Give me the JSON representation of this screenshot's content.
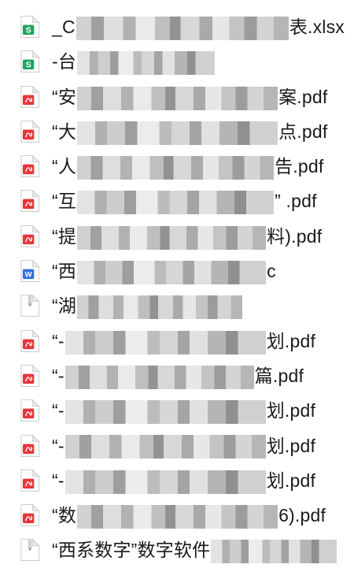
{
  "files": [
    {
      "type": "spreadsheet",
      "prefix": "_C",
      "suffix": "表.xlsx",
      "icon": "spreadsheet-icon",
      "color": "#1fa463",
      "glyph": "S"
    },
    {
      "type": "spreadsheet",
      "prefix": "-台",
      "suffix": "",
      "icon": "spreadsheet-icon",
      "color": "#1fa463",
      "glyph": "S"
    },
    {
      "type": "pdf",
      "prefix": "“安",
      "suffix": "案.pdf",
      "icon": "pdf-icon",
      "color": "#e5363b",
      "glyph": "PDF"
    },
    {
      "type": "pdf",
      "prefix": "“大",
      "suffix": "点.pdf",
      "icon": "pdf-icon",
      "color": "#e5363b",
      "glyph": "PDF"
    },
    {
      "type": "pdf",
      "prefix": "“人",
      "suffix": "告.pdf",
      "icon": "pdf-icon",
      "color": "#e5363b",
      "glyph": "PDF"
    },
    {
      "type": "pdf",
      "prefix": "“互",
      "suffix": "” .pdf",
      "icon": "pdf-icon",
      "color": "#e5363b",
      "glyph": "PDF"
    },
    {
      "type": "pdf",
      "prefix": "“提",
      "suffix": "料).pdf",
      "icon": "pdf-icon",
      "color": "#e5363b",
      "glyph": "PDF"
    },
    {
      "type": "word",
      "prefix": "“西",
      "suffix": "c",
      "icon": "word-document-icon",
      "color": "#2f6fe0",
      "glyph": "W"
    },
    {
      "type": "generic",
      "prefix": "“湖",
      "suffix": "",
      "icon": "generic-file-icon",
      "color": "#9a9a9a",
      "glyph": ""
    },
    {
      "type": "pdf",
      "prefix": "“-",
      "suffix": "划.pdf",
      "icon": "pdf-icon",
      "color": "#e5363b",
      "glyph": "PDF"
    },
    {
      "type": "pdf",
      "prefix": "“-",
      "suffix": "篇.pdf",
      "icon": "pdf-icon",
      "color": "#e5363b",
      "glyph": "PDF"
    },
    {
      "type": "pdf",
      "prefix": "“-",
      "suffix": "划.pdf",
      "icon": "pdf-icon",
      "color": "#e5363b",
      "glyph": "PDF"
    },
    {
      "type": "pdf",
      "prefix": "“-",
      "suffix": "划.pdf",
      "icon": "pdf-icon",
      "color": "#e5363b",
      "glyph": "PDF"
    },
    {
      "type": "pdf",
      "prefix": "“-",
      "suffix": "划.pdf",
      "icon": "pdf-icon",
      "color": "#e5363b",
      "glyph": "PDF"
    },
    {
      "type": "pdf",
      "prefix": "“数",
      "suffix": "6).pdf",
      "icon": "pdf-icon",
      "color": "#e5363b",
      "glyph": "PDF"
    },
    {
      "type": "generic",
      "prefix": "“西系数字”数字软件",
      "suffix": "",
      "icon": "generic-file-icon",
      "color": "#9a9a9a",
      "glyph": ""
    }
  ]
}
